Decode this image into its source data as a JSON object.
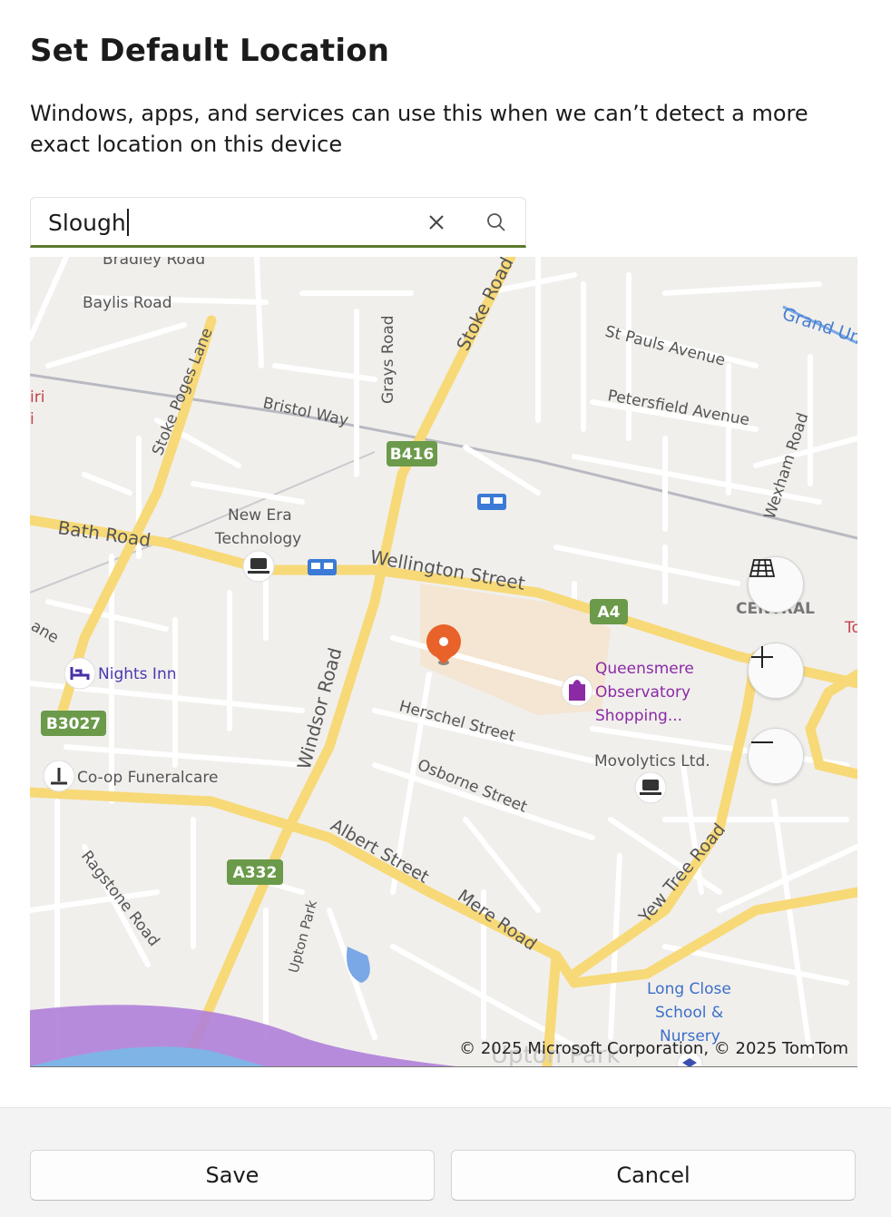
{
  "dialog": {
    "title": "Set Default Location",
    "description": "Windows, apps, and services can use this when we can’t detect a more exact location on this device"
  },
  "search": {
    "value": "Slough",
    "placeholder": ""
  },
  "map": {
    "attribution": "© 2025 Microsoft Corporation, © 2025 TomTom",
    "road_labels": [
      "Bradley Road",
      "Baylis Road",
      "Stoke Poges Lane",
      "Grays Road",
      "Stoke Road",
      "St Pauls Avenue",
      "Petersfield Avenue",
      "Grand Un",
      "Bristol Way",
      "Wexham Road",
      "Bath Road",
      "Wellington Street",
      "Windsor Road",
      "Herschel Street",
      "Osborne Street",
      "Albert Street",
      "Mere Road",
      "Yew Tree Road",
      "Ragstone Road",
      "Upton Park",
      "CENTRAL",
      "Upton Park",
      "ane",
      "iri",
      "i",
      "To"
    ],
    "road_shields": [
      "B416",
      "A4",
      "B3027",
      "A332"
    ],
    "pois": [
      {
        "name": "New Era Technology",
        "icon": "laptop-icon"
      },
      {
        "name": "Nights Inn",
        "icon": "bed-icon"
      },
      {
        "name": "Co-op Funeralcare",
        "icon": "funeral-icon"
      },
      {
        "name": "Queensmere Observatory Shopping...",
        "icon": "shopping-bag-icon"
      },
      {
        "name": "Movolytics Ltd.",
        "icon": "laptop-icon"
      },
      {
        "name": "Long Close School & Nursery",
        "icon": "school-icon"
      }
    ]
  },
  "buttons": {
    "save": "Save",
    "cancel": "Cancel"
  },
  "colors": {
    "accent_underline": "#5a7a2c",
    "pin": "#e8622a",
    "major_road": "#f7d978",
    "minor_road": "#ffffff",
    "poi_purple": "#8a2aa5",
    "shield_green": "#6b9a4a"
  }
}
